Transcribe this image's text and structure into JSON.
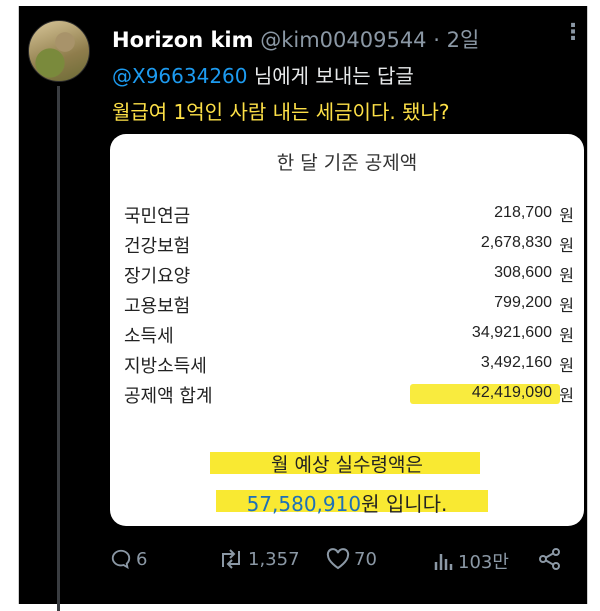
{
  "tweet": {
    "name": "Horizon kim",
    "handle": "@kim00409544",
    "separator": "·",
    "time": "2일",
    "more": "⋮",
    "reply_mention": "@X96634260",
    "reply_suffix": "님에게 보내는 답글",
    "text": "월급여 1억인 사람 내는 세금이다. 됐나?"
  },
  "card": {
    "title": "한 달 기준 공제액",
    "unit": "원",
    "rows": [
      {
        "label": "국민연금",
        "value": "218,700"
      },
      {
        "label": "건강보험",
        "value": "2,678,830"
      },
      {
        "label": "장기요양",
        "value": "308,600"
      },
      {
        "label": "고용보험",
        "value": "799,200"
      },
      {
        "label": "소득세",
        "value": "34,921,600"
      },
      {
        "label": "지방소득세",
        "value": "3,492,160"
      },
      {
        "label": "공제액 합계",
        "value": "42,419,090"
      }
    ],
    "summary_line1": "월 예상 실수령액은",
    "summary_amount": "57,580,910",
    "summary_suffix": "원 입니다."
  },
  "actions": {
    "replies": "6",
    "retweets": "1,357",
    "likes": "70",
    "views": "103만"
  },
  "colors": {
    "background": "#000000",
    "mention": "#1d9bf0",
    "highlight_text": "#fde047",
    "marker": "#f8e71c",
    "muted": "#8b98a5"
  }
}
